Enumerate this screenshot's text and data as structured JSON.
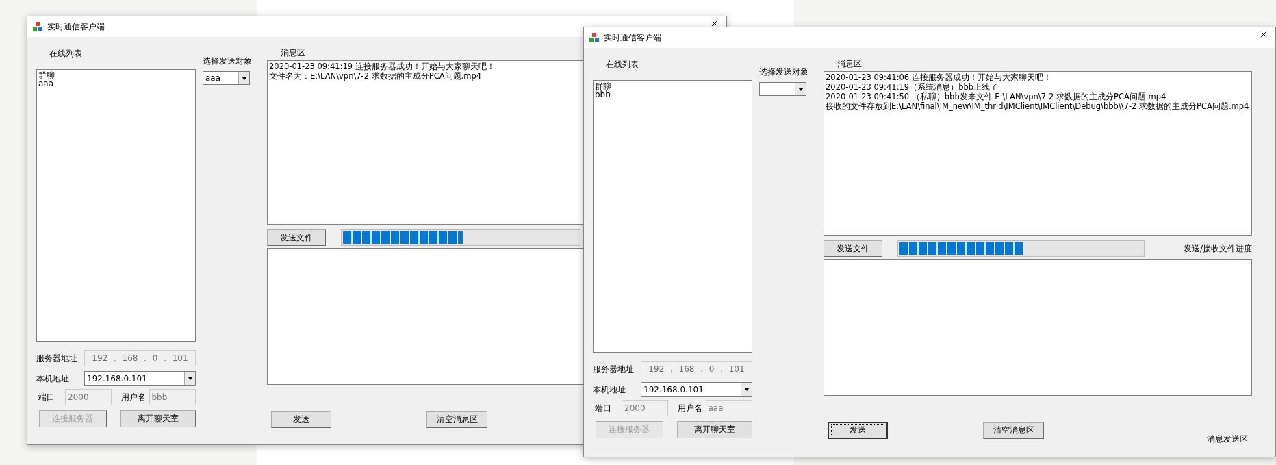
{
  "windows": [
    {
      "title": "实时通信客户端",
      "online_label": "在线列表",
      "online_list": [
        "群聊",
        "aaa"
      ],
      "target_label": "选择发送对象",
      "target_value": "aaa",
      "message_label": "消息区",
      "messages": [
        "2020-01-23 09:41:19 连接服务器成功！开始与大家聊天吧！",
        "文件名为：E:\\LAN\\vpn\\7-2 求数据的主成分PCA问题.mp4"
      ],
      "send_file_button": "发送文件",
      "progress": {
        "level": 0.51
      },
      "server_label": "服务器地址",
      "server_ip": {
        "octets": [
          "192",
          "168",
          "0",
          "101"
        ],
        "separator": ".",
        "disabled": true
      },
      "local_label": "本机地址",
      "local_ip": "192.168.0.101",
      "port_label": "端口",
      "port": {
        "value": "2000",
        "disabled": true
      },
      "user_label": "用户名",
      "user": {
        "value": "bbb",
        "disabled": true
      },
      "connect_button": {
        "label": "连接服务器",
        "disabled": true
      },
      "leave_button": "离开聊天室",
      "send_button": {
        "label": "发送",
        "focused": false
      },
      "clear_button": "清空消息区"
    },
    {
      "title": "实时通信客户端",
      "online_label": "在线列表",
      "online_list": [
        "群聊",
        "bbb"
      ],
      "target_label": "选择发送对象",
      "message_label": "消息区",
      "messages": [
        "2020-01-23 09:41:06 连接服务器成功！开始与大家聊天吧！",
        "2020-01-23 09:41:19（系统消息）bbb上线了",
        "2020-01-23 09:41:50 （私聊）bbb发来文件 E:\\LAN\\vpn\\7-2 求数据的主成分PCA问题.mp4",
        "接收的文件存放到E:\\LAN\\final\\IM_new\\IM_thrid\\IMClient\\IMClient\\Debug\\bbb\\\\7-2 求数据的主成分PCA问题.mp4"
      ],
      "send_file_button": "发送文件",
      "progress": {
        "level": 0.51
      },
      "progress_label": "发送/接收文件进度",
      "server_label": "服务器地址",
      "server_ip": {
        "octets": [
          "192",
          "168",
          "0",
          "101"
        ],
        "separator": ".",
        "disabled": true
      },
      "local_label": "本机地址",
      "local_ip": "192.168.0.101",
      "port_label": "端口",
      "port": {
        "value": "2000",
        "disabled": true
      },
      "user_label": "用户名",
      "user": {
        "value": "aaa",
        "disabled": true
      },
      "connect_button": {
        "label": "连接服务器",
        "disabled": true
      },
      "leave_button": "离开聊天室",
      "send_button": {
        "label": "发送",
        "focused": true
      },
      "clear_button": "清空消息区",
      "input_label": "消息发送区"
    }
  ]
}
